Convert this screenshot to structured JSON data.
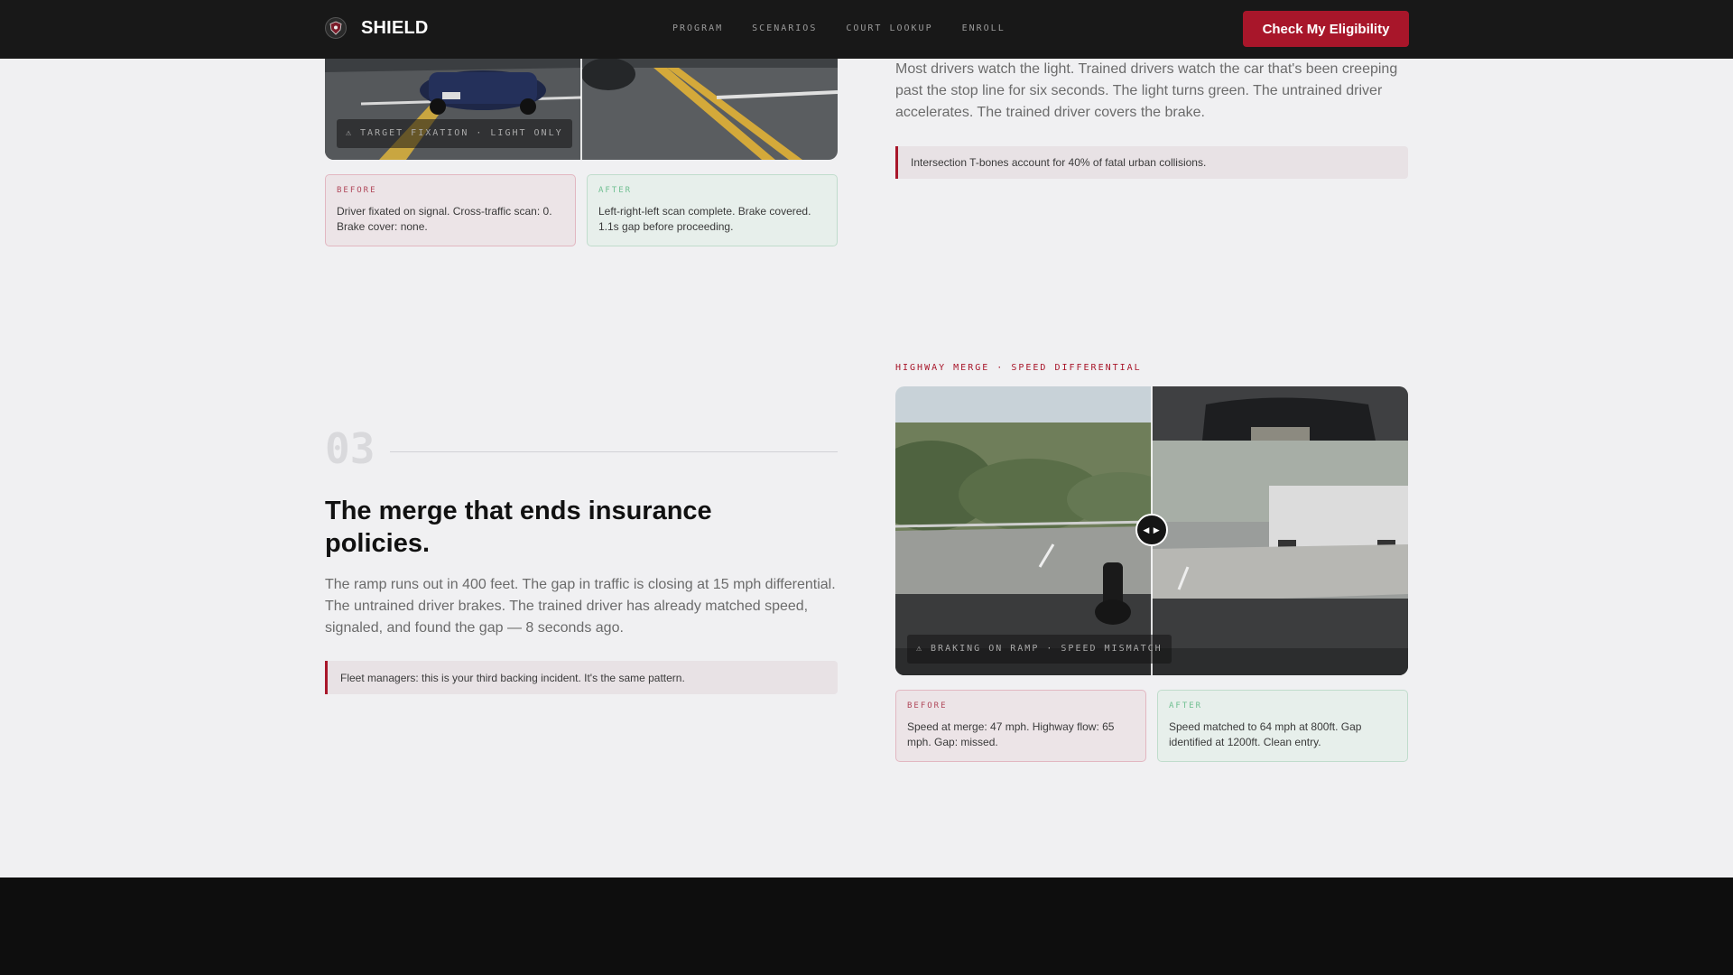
{
  "nav": {
    "brand": "SHIELD",
    "links": [
      "PROGRAM",
      "SCENARIOS",
      "COURT LOOKUP",
      "ENROLL"
    ],
    "cta": "Check My Eligibility"
  },
  "scenario_intersection": {
    "image_tag": "⚠ TARGET FIXATION · LIGHT ONLY",
    "before_label": "BEFORE",
    "before_text": "Driver fixated on signal. Cross-traffic scan: 0. Brake cover: none.",
    "after_label": "AFTER",
    "after_text": "Left-right-left scan complete. Brake covered. 1.1s gap before proceeding.",
    "body": "Most drivers watch the light. Trained drivers watch the car that's been creeping past the stop line for six seconds. The light turns green. The untrained driver accelerates. The trained driver covers the brake.",
    "callout": "Intersection T-bones account for 40% of fatal urban collisions."
  },
  "scenario_merge": {
    "eyebrow": "HIGHWAY MERGE · SPEED DIFFERENTIAL",
    "number": "03",
    "heading": "The merge that ends insurance policies.",
    "body": "The ramp runs out in 400 feet. The gap in traffic is closing at 15 mph differential. The untrained driver brakes. The trained driver has already matched speed, signaled, and found the gap — 8 seconds ago.",
    "callout": "Fleet managers: this is your third backing incident. It's the same pattern.",
    "image_tag": "⚠ BRAKING ON RAMP · SPEED MISMATCH",
    "handle": "◀ ▶",
    "before_label": "BEFORE",
    "before_text": "Speed at merge: 47 mph. Highway flow: 65 mph. Gap: missed.",
    "after_label": "AFTER",
    "after_text": "Speed matched to 64 mph at 800ft. Gap identified at 1200ft. Clean entry."
  },
  "colors": {
    "accent": "#a8162a",
    "nav_bg": "#181818",
    "page_bg": "#f0f0f2",
    "before_bg": "#ece4e7",
    "after_bg": "#e7efeb"
  }
}
